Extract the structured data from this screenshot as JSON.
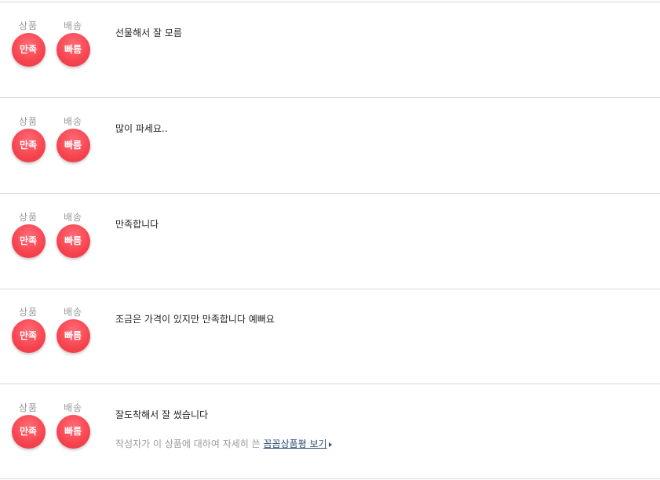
{
  "reviews": [
    {
      "product_label": "상품",
      "product_badge": "만족",
      "delivery_label": "배송",
      "delivery_badge": "빠름",
      "text": "선물해서 잘 모름"
    },
    {
      "product_label": "상품",
      "product_badge": "만족",
      "delivery_label": "배송",
      "delivery_badge": "빠름",
      "text": "많이 파세요.."
    },
    {
      "product_label": "상품",
      "product_badge": "만족",
      "delivery_label": "배송",
      "delivery_badge": "빠름",
      "text": "만족합니다"
    },
    {
      "product_label": "상품",
      "product_badge": "만족",
      "delivery_label": "배송",
      "delivery_badge": "빠름",
      "text": "조금은 가격이 있지만 만족합니다 예뻐요"
    },
    {
      "product_label": "상품",
      "product_badge": "만족",
      "delivery_label": "배송",
      "delivery_badge": "빠름",
      "text": "잘도착해서 잘 썼습니다"
    }
  ],
  "detail_note": {
    "prefix": "작성자가 이 상품에 대하여 자세히 쓴 ",
    "link_label": "꼼꼼상품평 보기"
  }
}
